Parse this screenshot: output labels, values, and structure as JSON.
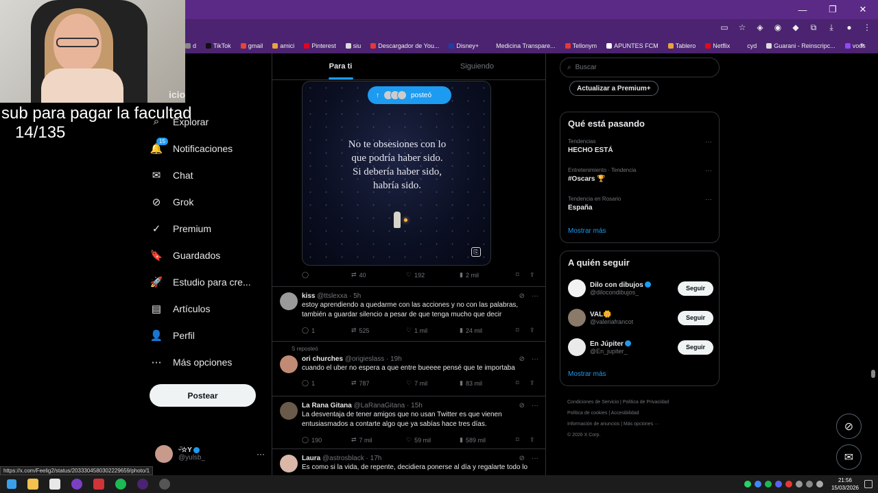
{
  "window": {
    "controls": [
      "—",
      "❐",
      "✕"
    ]
  },
  "bookmarks": [
    {
      "label": "d",
      "color": "#888888"
    },
    {
      "label": "TikTok",
      "color": "#111111"
    },
    {
      "label": "gmail",
      "color": "#ea4335"
    },
    {
      "label": "amici",
      "color": "#e8a33d"
    },
    {
      "label": "Pinterest",
      "color": "#e60023"
    },
    {
      "label": "siu",
      "color": "#dddddd"
    },
    {
      "label": "Descargador de You...",
      "color": "#e53935"
    },
    {
      "label": "Disney+",
      "color": "#1a3fa6"
    },
    {
      "label": "Medicina Transpare...",
      "color": "#4b2370"
    },
    {
      "label": "Tellonym",
      "color": "#e53935"
    },
    {
      "label": "APUNTES FCM",
      "color": "#ffffff"
    },
    {
      "label": "Tablero",
      "color": "#e8a33d"
    },
    {
      "label": "Netflix",
      "color": "#e50914"
    },
    {
      "label": "cyd",
      "color": "#4b2370"
    },
    {
      "label": "Guarani - Reinscripc...",
      "color": "#dddddd"
    },
    {
      "label": "vods",
      "color": "#9147ff"
    }
  ],
  "overlay": {
    "line1": "sub para pagar la facultad",
    "line2": "14/135"
  },
  "nav": {
    "partial_home": "icio",
    "items": [
      {
        "label": "Explorar",
        "icon": "search-icon",
        "glyph": "⌕"
      },
      {
        "label": "Notificaciones",
        "icon": "bell-icon",
        "glyph": "🔔",
        "badge": "15"
      },
      {
        "label": "Chat",
        "icon": "mail-icon",
        "glyph": "✉"
      },
      {
        "label": "Grok",
        "icon": "grok-icon",
        "glyph": "⊘"
      },
      {
        "label": "Premium",
        "icon": "verified-icon",
        "glyph": "✓"
      },
      {
        "label": "Guardados",
        "icon": "bookmark-icon",
        "glyph": "🔖"
      },
      {
        "label": "Estudio para cre...",
        "icon": "rocket-icon",
        "glyph": "🚀"
      },
      {
        "label": "Artículos",
        "icon": "article-icon",
        "glyph": "▤"
      },
      {
        "label": "Perfil",
        "icon": "person-icon",
        "glyph": "👤"
      },
      {
        "label": "Más opciones",
        "icon": "more-circle-icon",
        "glyph": "⋯"
      }
    ],
    "post_button": "Postear"
  },
  "profile": {
    "name": "ᵕ̈☆Y",
    "handle": "@yulsb_"
  },
  "tabs": [
    "Para ti",
    "Siguiendo"
  ],
  "first_post": {
    "quote_lines": [
      "No te obsesiones con lo",
      "que podría haber sido.",
      "Si debería haber sido,",
      "habría sido."
    ],
    "pill_label": "posteó",
    "replies": "",
    "reposts": "40",
    "likes": "192",
    "views": "2 mil"
  },
  "tweets": [
    {
      "name": "kiss",
      "handle": "@ttslexxa",
      "time": "· 5h",
      "text": "estoy aprendiendo a quedarme con las acciones y no con las palabras, también a guardar silencio a pesar de que tenga mucho que decir",
      "replies": "1",
      "reposts": "525",
      "likes": "1 mil",
      "views": "24 mil",
      "avatar_color": "#9a9a9a"
    },
    {
      "repost_note": "S reposteó",
      "name": "ori churches",
      "handle": "@origieslass",
      "time": "· 19h",
      "text": "cuando el uber no espera a que entre bueeee pensé que te importaba",
      "replies": "1",
      "reposts": "787",
      "likes": "7 mil",
      "views": "83 mil",
      "avatar_color": "#c08a74"
    },
    {
      "name": "La Rana Gitana",
      "handle": "@LaRanaGitana",
      "time": "· 15h",
      "text": "La desventaja de tener amigos que no usan Twitter es que vienen entusiasmados a contarte algo que ya sabías hace tres días.",
      "replies": "190",
      "reposts": "7 mil",
      "likes": "59 mil",
      "views": "589 mil",
      "avatar_color": "#6a5a4a"
    },
    {
      "name": "Laura",
      "handle": "@astrosblack",
      "time": "· 17h",
      "text": "Es como si la vida, de repente, decidiera ponerse al día y regalarte todo lo",
      "avatar_color": "#d9b8a8"
    }
  ],
  "right": {
    "search_placeholder": "Buscar",
    "premium_button": "Actualizar a Premium+",
    "trends_title": "Qué está pasando",
    "trends": [
      {
        "meta": "Tendencias",
        "title": "HECHO ESTÁ"
      },
      {
        "meta": "Entretenimiento · Tendencia",
        "title": "#Oscars 🏆"
      },
      {
        "meta": "Tendencia en Rosario",
        "title": "España"
      }
    ],
    "show_more": "Mostrar más",
    "who_title": "A quién seguir",
    "who": [
      {
        "name": "Dilo con dibujos",
        "handle": "@dilocondibujos_",
        "avatar_color": "#f2f2f2"
      },
      {
        "name": "VAL🌼",
        "handle": "@valeriafrancot",
        "avatar_color": "#8a7a6a"
      },
      {
        "name": "En Júpiter",
        "handle": "@En_jupiter_",
        "avatar_color": "#eaeaea"
      }
    ],
    "follow_label": "Seguir",
    "footer": [
      [
        "Condiciones de Servicio",
        "Política de Privacidad"
      ],
      [
        "Política de cookies",
        "Accesibilidad"
      ],
      [
        "Información de anuncios",
        "Más opciones ···"
      ],
      [
        "© 2026 X Corp."
      ]
    ]
  },
  "status_url": "https://x.com/Feelig2/status/2033304580302229659/photo/1",
  "clock": {
    "time": "21:56",
    "date": "15/03/2026"
  }
}
